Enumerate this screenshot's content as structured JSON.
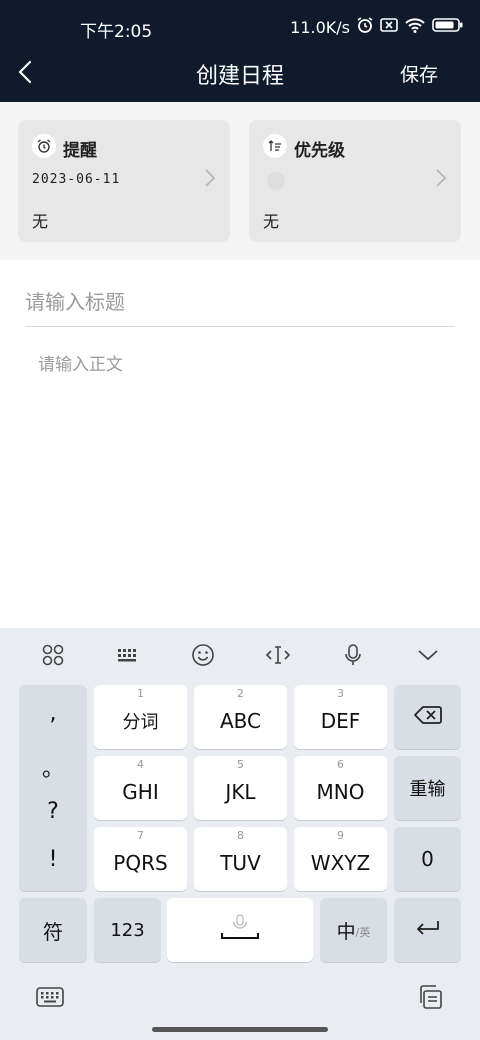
{
  "status": {
    "time": "下午2:05",
    "speed": "11.0K/s"
  },
  "nav": {
    "title": "创建日程",
    "save": "保存"
  },
  "reminder": {
    "title": "提醒",
    "date": "2023-06-11",
    "value": "无"
  },
  "priority": {
    "title": "优先级",
    "value": "无"
  },
  "form": {
    "title_placeholder": "请输入标题",
    "body_placeholder": "请输入正文"
  },
  "keyboard": {
    "punct": [
      ",",
      "。",
      "?",
      "!"
    ],
    "keys": [
      {
        "num": "1",
        "label": "分词"
      },
      {
        "num": "2",
        "label": "ABC"
      },
      {
        "num": "3",
        "label": "DEF"
      },
      {
        "num": "4",
        "label": "GHI"
      },
      {
        "num": "5",
        "label": "JKL"
      },
      {
        "num": "6",
        "label": "MNO"
      },
      {
        "num": "7",
        "label": "PQRS"
      },
      {
        "num": "8",
        "label": "TUV"
      },
      {
        "num": "9",
        "label": "WXYZ"
      }
    ],
    "reinput": "重输",
    "zero": "0",
    "symbols": "符",
    "numbers": "123",
    "lang_main": "中",
    "lang_sub": "/英"
  }
}
